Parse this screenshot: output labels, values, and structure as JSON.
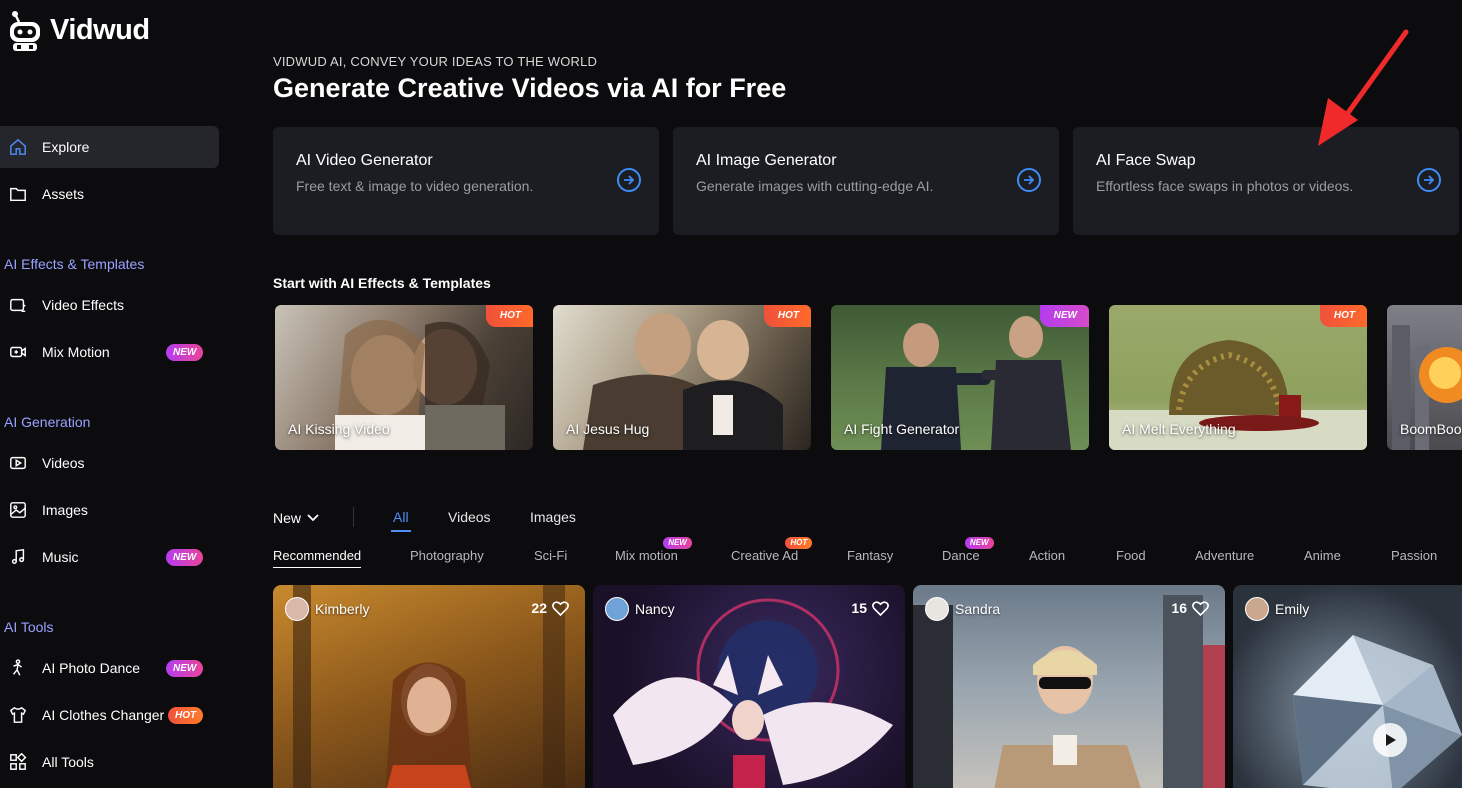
{
  "brand": {
    "name": "Vidwud"
  },
  "sidebar": {
    "explore": "Explore",
    "assets": "Assets",
    "sections": {
      "effects": "AI Effects & Templates",
      "generation": "AI Generation",
      "tools": "AI Tools"
    },
    "video_effects": "Video Effects",
    "mix_motion": "Mix Motion",
    "videos": "Videos",
    "images": "Images",
    "music": "Music",
    "photo_dance": "AI Photo Dance",
    "clothes_changer": "AI Clothes Changer",
    "all_tools": "All Tools",
    "badge_new": "NEW",
    "badge_hot": "HOT"
  },
  "hero": {
    "kicker": "VIDWUD AI, CONVEY YOUR IDEAS TO THE WORLD",
    "title": "Generate Creative Videos via AI for Free"
  },
  "features": [
    {
      "title": "AI Video Generator",
      "desc": "Free text & image to video generation."
    },
    {
      "title": "AI Image Generator",
      "desc": "Generate images with cutting-edge AI."
    },
    {
      "title": "AI Face Swap",
      "desc": "Effortless face swaps in photos or videos."
    }
  ],
  "templates_title": "Start with AI Effects & Templates",
  "templates": [
    {
      "label": "AI Kissing Video",
      "tag": "HOT"
    },
    {
      "label": "AI Jesus Hug",
      "tag": "HOT"
    },
    {
      "label": "AI Fight Generator",
      "tag": "NEW"
    },
    {
      "label": "AI Melt Everything",
      "tag": "HOT"
    },
    {
      "label": "BoomBoo",
      "tag": ""
    }
  ],
  "filters": {
    "sort": "New",
    "types": [
      "All",
      "Videos",
      "Images"
    ],
    "categories": [
      "Recommended",
      "Photography",
      "Sci-Fi",
      "Mix motion",
      "Creative Ad",
      "Fantasy",
      "Dance",
      "Action",
      "Food",
      "Adventure",
      "Anime",
      "Passion"
    ],
    "cat_badges": {
      "mix": "NEW",
      "creative": "HOT",
      "dance": "NEW"
    }
  },
  "posts": [
    {
      "user": "Kimberly",
      "likes": "22"
    },
    {
      "user": "Nancy",
      "likes": "15"
    },
    {
      "user": "Sandra",
      "likes": "16"
    },
    {
      "user": "Emily",
      "likes": ""
    }
  ],
  "colors": {
    "accent": "#4f8df7",
    "hot": "#f0513a",
    "new": "#b53cf0",
    "card": "#1c1d22"
  }
}
